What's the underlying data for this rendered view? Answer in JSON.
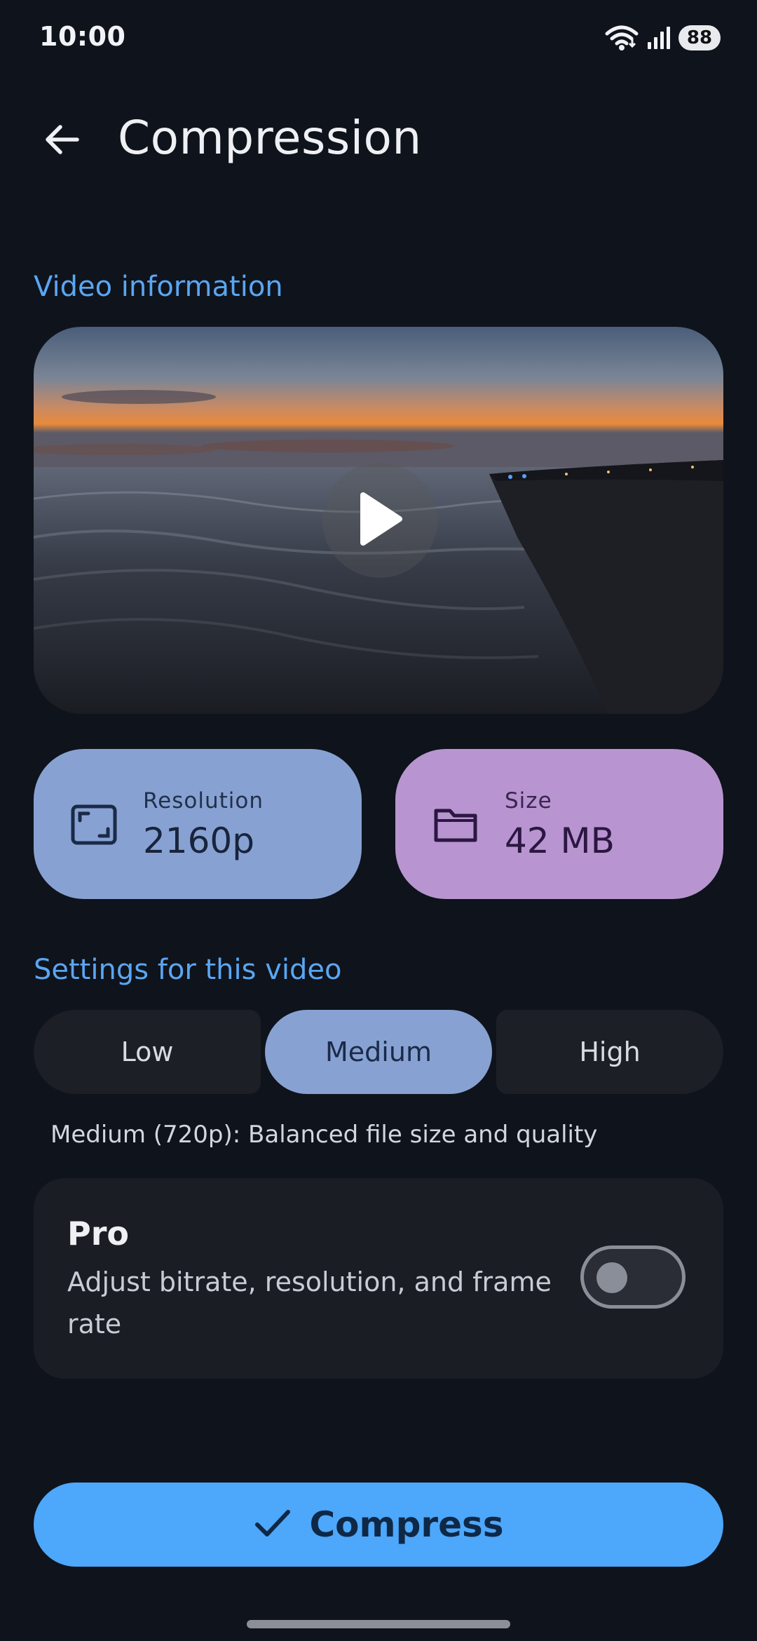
{
  "status_bar": {
    "time": "10:00",
    "battery": "88"
  },
  "app_bar": {
    "title": "Compression"
  },
  "video_section": {
    "title": "Video information"
  },
  "info_cards": {
    "resolution": {
      "label": "Resolution",
      "value": "2160p"
    },
    "size": {
      "label": "Size",
      "value": "42 MB"
    }
  },
  "settings_section": {
    "title": "Settings for this video"
  },
  "quality_options": {
    "low": "Low",
    "medium": "Medium",
    "high": "High",
    "selected": "Medium",
    "description": "Medium (720p): Balanced file size and quality"
  },
  "pro": {
    "title": "Pro",
    "description": "Adjust bitrate, resolution, and frame rate",
    "enabled": false
  },
  "compress_button": {
    "label": "Compress"
  },
  "colors": {
    "background": "#0f131b",
    "accent": "#5aa6f2",
    "resolution_card": "#87a2d2",
    "size_card": "#b895d0",
    "compress_button": "#4da7fa"
  },
  "icons": {
    "back": "arrow-left-icon",
    "play": "play-icon",
    "resolution": "aspect-ratio-icon",
    "size": "folder-icon",
    "compress": "check-icon"
  }
}
